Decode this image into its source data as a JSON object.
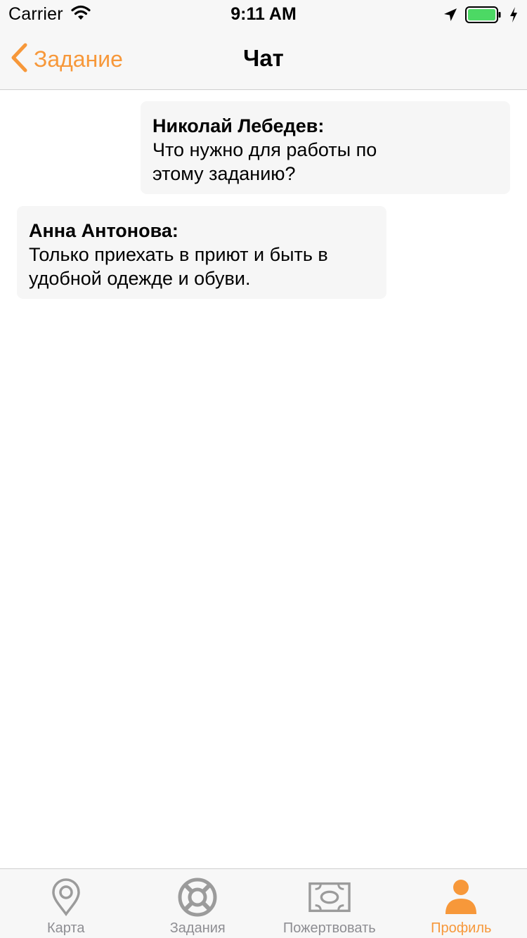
{
  "status_bar": {
    "carrier": "Carrier",
    "time": "9:11 AM",
    "battery_color": "#4cd964"
  },
  "nav": {
    "back_label": "Задание",
    "title": "Чат",
    "accent_color": "#f7983a"
  },
  "messages": [
    {
      "author": "Николай Лебедев:",
      "text": "Что нужно для работы по\nэтому заданию?",
      "side": "right"
    },
    {
      "author": "Анна Антонова:",
      "text": "Только приехать в приют и быть в\nудобной одежде и обуви.",
      "side": "left"
    }
  ],
  "tabs": [
    {
      "label": "Карта",
      "icon": "map-pin-icon",
      "active": false
    },
    {
      "label": "Задания",
      "icon": "lifebuoy-icon",
      "active": false
    },
    {
      "label": "Пожертвовать",
      "icon": "banknote-icon",
      "active": false
    },
    {
      "label": "Профиль",
      "icon": "profile-icon",
      "active": true
    }
  ]
}
